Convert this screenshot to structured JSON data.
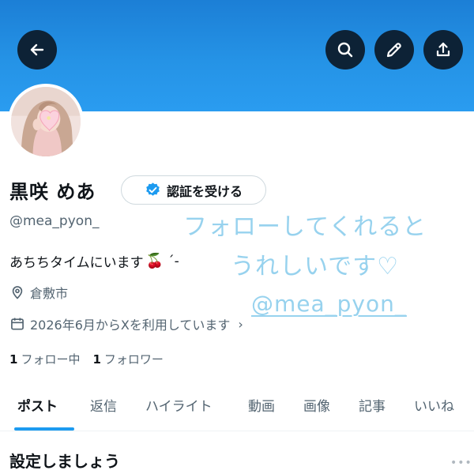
{
  "header": {
    "back_icon": "arrow-left-icon",
    "search_icon": "search-icon",
    "edit_icon": "pencil-icon",
    "share_icon": "share-icon",
    "banner_color": "#2593e6",
    "button_bg": "#0d2236"
  },
  "profile": {
    "display_name": "黒咲 めあ",
    "verify_label": "認証を受ける",
    "handle": "@mea_pyon_",
    "bio_text": "あちちタイムにいます",
    "bio_emoji": "🍒",
    "bio_tail": "´-",
    "location": "倉敷市",
    "joined": "2026年6月からXを利用しています",
    "following_count": "1",
    "following_label": "フォロー中",
    "followers_count": "1",
    "followers_label": "フォロワー"
  },
  "tabs": [
    {
      "label": "ポスト",
      "active": true
    },
    {
      "label": "返信",
      "active": false
    },
    {
      "label": "ハイライト",
      "active": false
    },
    {
      "label": "動画",
      "active": false
    },
    {
      "label": "画像",
      "active": false
    },
    {
      "label": "記事",
      "active": false
    },
    {
      "label": "いいね",
      "active": false
    }
  ],
  "section": {
    "title": "設定しましょう",
    "more": "•••"
  },
  "overlay": {
    "line1": "フォローしてくれると",
    "line2": "うれしいです♡",
    "handle": "@mea_pyon_",
    "color": "#97d2ee"
  },
  "accent_color": "#1d9bf0"
}
